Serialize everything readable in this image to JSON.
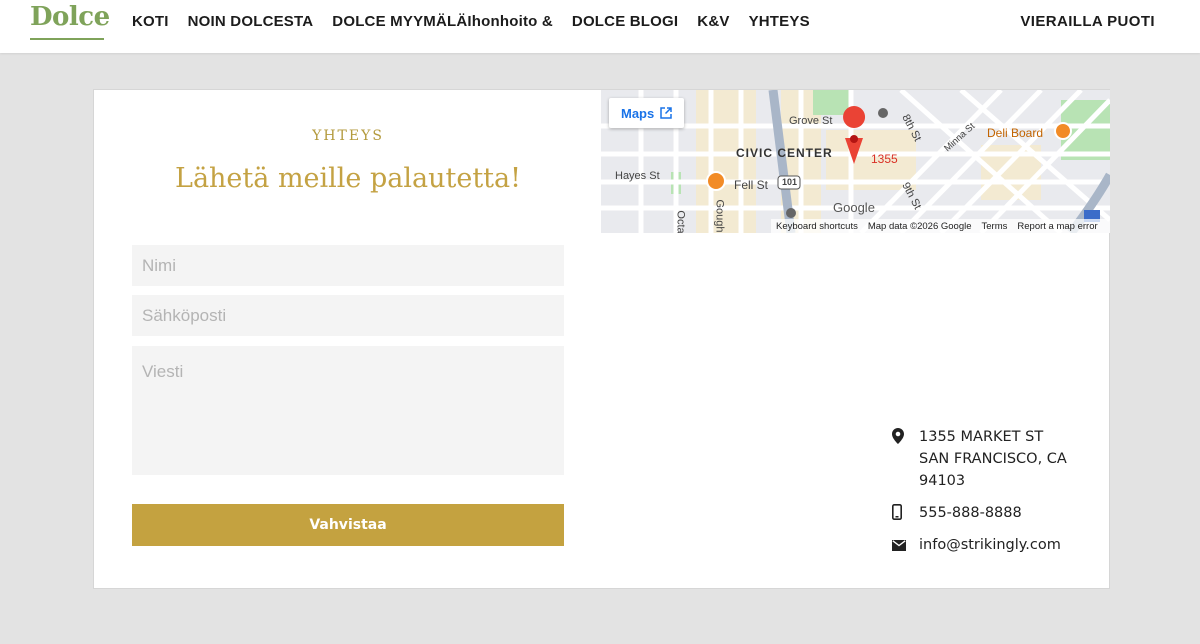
{
  "header": {
    "logo": "Dolce",
    "nav": [
      "KOTI",
      "NOIN DOLCESTA",
      "DOLCE MYYMÄLÄIhonhoito &",
      "DOLCE BLOGI",
      "K&V",
      "YHTEYS"
    ],
    "visit_label": "VIERAILLA PUOTI"
  },
  "section": {
    "kicker": "YHTEYS",
    "title": "Lähetä meille palautetta!"
  },
  "form": {
    "name_placeholder": "Nimi",
    "email_placeholder": "Sähköposti",
    "message_placeholder": "Viesti",
    "submit_label": "Vahvistaa"
  },
  "map": {
    "maps_link": "Maps",
    "pin_label": "1355",
    "place_label": "Deli Board",
    "district": "CIVIC CENTER",
    "streets": [
      "Grove St",
      "Hayes St",
      "Fell St",
      "8th St",
      "9th St",
      "Minna St",
      "Gough",
      "Octa"
    ],
    "highway": "101",
    "google": "Google",
    "footer": [
      "Keyboard shortcuts",
      "Map data ©2026 Google",
      "Terms",
      "Report a map error"
    ]
  },
  "contact": {
    "address_line1": "1355 MARKET ST",
    "address_line2": "SAN FRANCISCO, CA",
    "address_line3": "94103",
    "phone": "555-888-8888",
    "email": "info@strikingly.com"
  },
  "colors": {
    "logo": "#7fa35a",
    "accent": "#c4a240",
    "background": "#e3e3e3"
  }
}
